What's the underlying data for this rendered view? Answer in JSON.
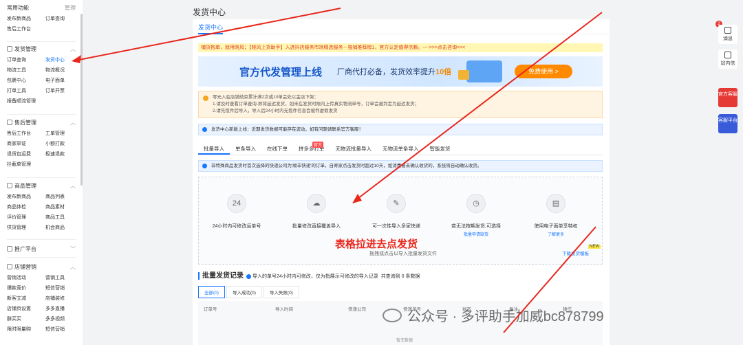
{
  "sidebar": {
    "common": {
      "title": "常用功能",
      "manage": "管理",
      "items": [
        "发布新商品",
        "订单查询",
        "售后工作台"
      ]
    },
    "shipping": {
      "title": "发货管理",
      "items": [
        "订单查询",
        "发货中心",
        "物流工具",
        "物流概况",
        "包裹中心",
        "电子面单",
        "打单工具",
        "订单开票",
        "报备顺流管理"
      ]
    },
    "aftersale": {
      "title": "售后管理",
      "items": [
        "售后工作台",
        "工单管理",
        "商家举证",
        "小额打款",
        "退货包运费",
        "极速退款",
        "拦截单管理"
      ]
    },
    "goods": {
      "title": "商品管理",
      "items": [
        "发布新商品",
        "商品列表",
        "商品体检",
        "商品素材",
        "评价管理",
        "商品工具",
        "供货管理",
        "机会商品"
      ]
    },
    "promo": {
      "title": "推广平台"
    },
    "marketing": {
      "title": "店铺营销",
      "items": [
        "营销活动",
        "营销工具",
        "爆款竞价",
        "短信营销",
        "新客立减",
        "店铺装修",
        "店铺页设置",
        "多多直播",
        "群买买",
        "多多视频",
        "限时限量购",
        "短信营销"
      ]
    }
  },
  "page_title": "发货中心",
  "tab": "发货中心",
  "notice": "铺货抱单，就用晓风；【晓风上货助手】入选抖店服务市场精选服务－独销推荐榜1，官方认定值得信赖。---->>>点击咨询<<<",
  "banner": {
    "title": "官方代发管理上线",
    "subtitle_a": "厂商代打必备，发货效率提升",
    "subtitle_b": "10倍",
    "button": "免费使用 >"
  },
  "warn": {
    "line1": "零元入驻店铺结束累计满2次或10单会处以金店下架：",
    "line2": "1.请及时查看订单查询-即将延迟发货，如未在发货时限内上传真实物流单号，订单会被判定为延迟发货；",
    "line3": "2.请先揽件后导入，导入后24小时内无揽件信息会被判虚假发货"
  },
  "info1": "发货中心新版上线：近期发货数据可能存在波动，如有问题请联系官方客服！",
  "methods": [
    "批量导入",
    "单条导入",
    "在线下单",
    "拼多多打单",
    "无物流批量导入",
    "无物流单条导入",
    "智能发货"
  ],
  "hot_badge": "官方",
  "info2": "非特殊商品发货时首次选择的快递公司为'顺丰快递'的订单，自寄家点击发货时超过10天，如消费者未确认收货的，系统将自动确认收货。",
  "features": [
    {
      "icon": "24",
      "title": "24小时内可修改运单号",
      "sub": ""
    },
    {
      "icon": "☁",
      "title": "批量修改直接覆盖导入",
      "sub": ""
    },
    {
      "icon": "✎",
      "title": "可一次性导入多家快递",
      "sub": ""
    },
    {
      "icon": "◷",
      "title": "若无法按期发货,可选择",
      "sub": "批量申请缺货"
    },
    {
      "icon": "▤",
      "title": "使用电子面单享特权",
      "sub": "了解更多"
    }
  ],
  "annotation": "表格拉进去点发货",
  "drag_text": "拖拽或点击以导入批量发货文件",
  "download": "下载发货模板",
  "new_badge": "NEW",
  "record": {
    "title": "批量发货记录",
    "desc": "导入的单号24小时内可修改，仅为指展示可修改的导入记录",
    "count": "共查询到 0 条数据"
  },
  "record_tabs": [
    "全部(0)",
    "导入成功(0)",
    "导入失败(0)"
  ],
  "columns": [
    "订单号",
    "导入时间",
    "快递公司",
    "快递单号",
    "状态",
    "备注",
    "操作"
  ],
  "empty": "暂无数据",
  "right_panel": {
    "badge": "2",
    "msg": "消息",
    "inbox": "站内信",
    "service": "官方客服",
    "service_platform": "客服平台"
  },
  "watermark": "公众号 · 多评助手加威bc878799",
  "colors": {
    "accent": "#1677ff",
    "arrow": "#e8261c",
    "banner_button": "#ff8a00"
  }
}
